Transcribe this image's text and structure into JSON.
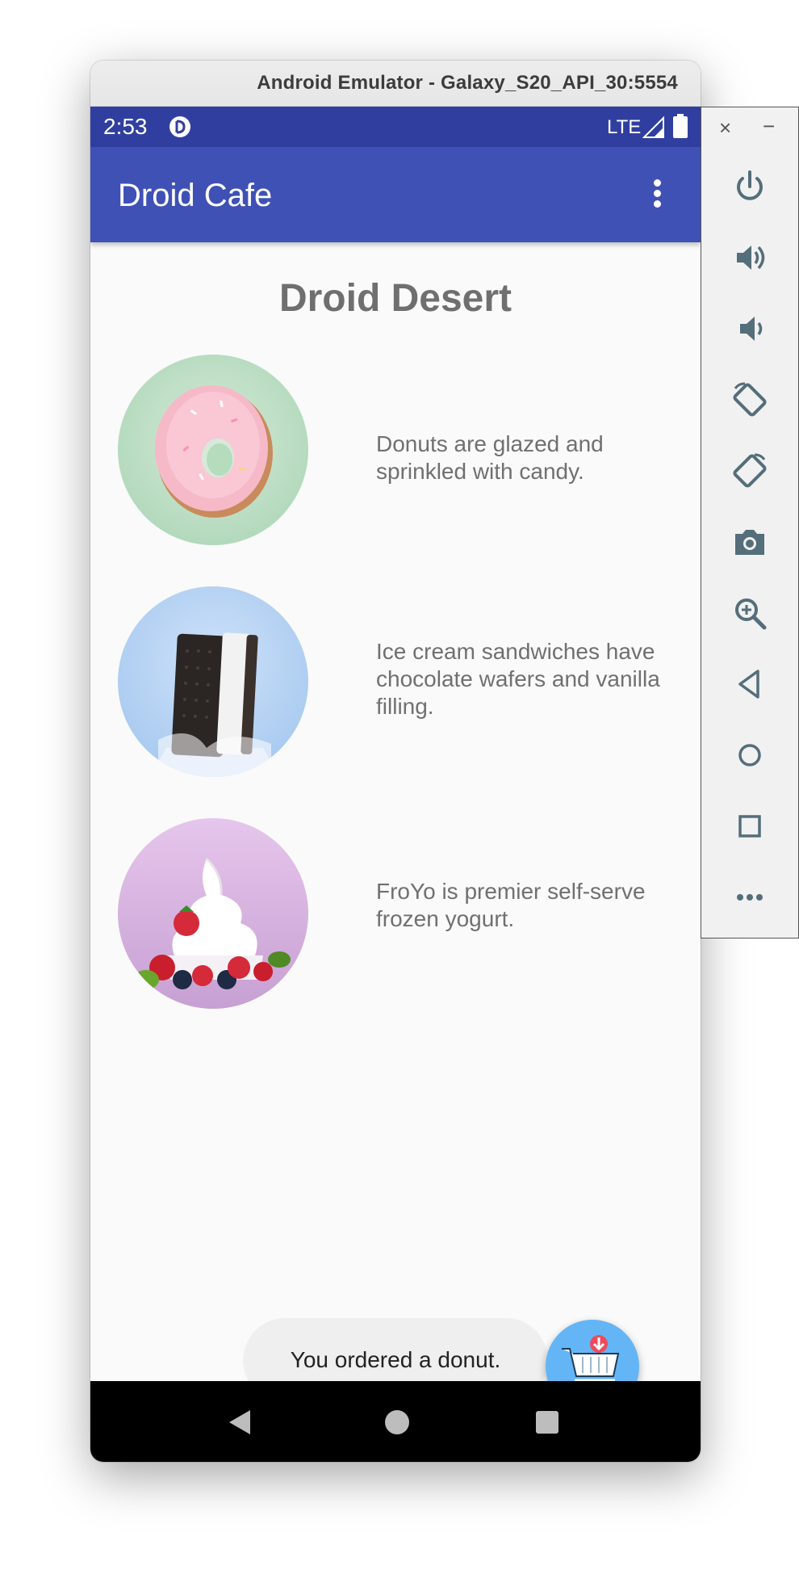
{
  "window": {
    "title": "Android Emulator - Galaxy_S20_API_30:5554"
  },
  "status_bar": {
    "time": "2:53",
    "network": "LTE"
  },
  "app_bar": {
    "title": "Droid Cafe",
    "overflow_icon": "more-vert-icon"
  },
  "content": {
    "heading": "Droid Desert",
    "desserts": [
      {
        "name": "donut",
        "description": "Donuts are glazed and sprinkled with candy."
      },
      {
        "name": "ice-cream-sandwich",
        "description": "Ice cream sandwiches have chocolate wafers and vanilla filling."
      },
      {
        "name": "froyo",
        "description": "FroYo is premier self-serve frozen yogurt."
      }
    ]
  },
  "toast": {
    "message": "You ordered a donut."
  },
  "fab": {
    "icon": "shopping-cart-icon"
  },
  "nav_bar": {
    "buttons": [
      "back-icon",
      "home-icon",
      "recents-icon"
    ]
  },
  "toolbar": {
    "close": "×",
    "minimize": "−",
    "tools": [
      "power-icon",
      "volume-up-icon",
      "volume-down-icon",
      "rotate-left-icon",
      "rotate-right-icon",
      "camera-icon",
      "zoom-icon",
      "back-icon",
      "home-icon",
      "overview-icon",
      "more-icon"
    ]
  },
  "colors": {
    "status_bar": "#303f9f",
    "app_bar": "#3f51b5",
    "fab": "#64b5f6",
    "toolbar_icon": "#546e7a"
  }
}
